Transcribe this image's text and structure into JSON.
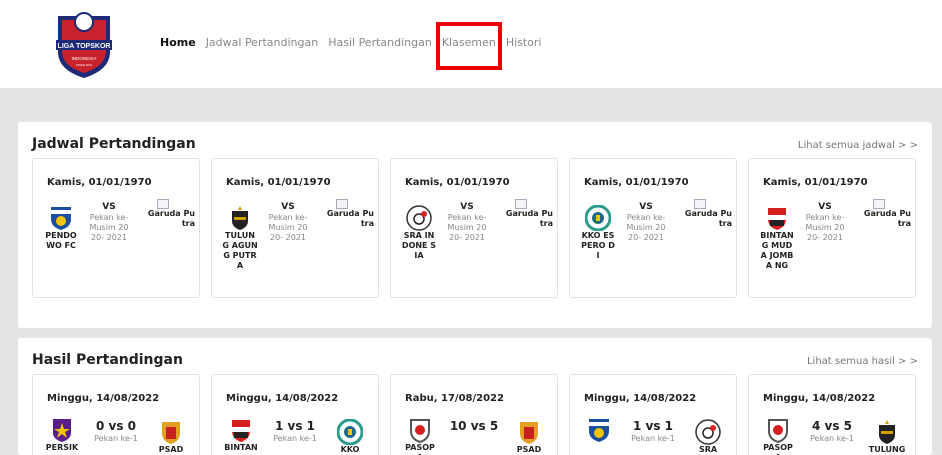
{
  "header": {
    "logo": {
      "text_top": "LIGA TOPSKOR",
      "text_mid": "INDONESIA",
      "text_bot": "SINCE 2011",
      "color": "#1e2a78"
    },
    "nav": [
      {
        "label": "Home",
        "active": true
      },
      {
        "label": "Jadwal Pertandingan",
        "active": false
      },
      {
        "label": "Hasil Pertandingan",
        "active": false
      },
      {
        "label": "Klasemen",
        "active": false
      },
      {
        "label": "Histori",
        "active": false
      }
    ]
  },
  "jadwal": {
    "title": "Jadwal Pertandingan",
    "link": "Lihat semua jadwal > >",
    "cards": [
      {
        "date": "Kamis, 01/01/1970",
        "home": "PENDO WO FC",
        "vs": "VS",
        "pekan": "Pekan ke- Musim 2020- 2021",
        "away": "Garuda Putra",
        "home_icon": "pendowo-crest-icon"
      },
      {
        "date": "Kamis, 01/01/1970",
        "home": "TULUNG AGUNG PUTRA",
        "vs": "VS",
        "pekan": "Pekan ke- Musim 2020- 2021",
        "away": "Garuda Putra",
        "home_icon": "tulungagung-crest-icon"
      },
      {
        "date": "Kamis, 01/01/1970",
        "home": "SRA INDONE SIA",
        "vs": "VS",
        "pekan": "Pekan ke- Musim 2020- 2021",
        "away": "Garuda Putra",
        "home_icon": "sra-crest-icon"
      },
      {
        "date": "Kamis, 01/01/1970",
        "home": "KKO ESPERO DI",
        "vs": "VS",
        "pekan": "Pekan ke- Musim 2020- 2021",
        "away": "Garuda Putra",
        "home_icon": "kko-crest-icon"
      },
      {
        "date": "Kamis, 01/01/1970",
        "home": "BINTAN G MUDA JOMBA NG",
        "vs": "VS",
        "pekan": "Pekan ke- Musim 2020- 2021",
        "away": "Garuda Putra",
        "home_icon": "bintang-crest-icon"
      }
    ]
  },
  "hasil": {
    "title": "Hasil Pertandingan",
    "link": "Lihat semua hasil > >",
    "cards": [
      {
        "date": "Minggu, 14/08/2022",
        "score": "0 vs 0",
        "pekan": "Pekan ke-1",
        "home": "PERSIK",
        "away": "PSAD"
      },
      {
        "date": "Minggu, 14/08/2022",
        "score": "1 vs 1",
        "pekan": "Pekan ke-1",
        "home": "BINTAN",
        "away": "KKO"
      },
      {
        "date": "Rabu, 17/08/2022",
        "score": "10 vs 5",
        "pekan": "",
        "home": "PASOPA",
        "away": "PSAD"
      },
      {
        "date": "Minggu, 14/08/2022",
        "score": "1 vs 1",
        "pekan": "Pekan ke-1",
        "home": "",
        "away": "SRA"
      },
      {
        "date": "Minggu, 14/08/2022",
        "score": "4 vs 5",
        "pekan": "Pekan ke-1",
        "home": "PASOPA",
        "away": "TULUNG"
      }
    ]
  }
}
